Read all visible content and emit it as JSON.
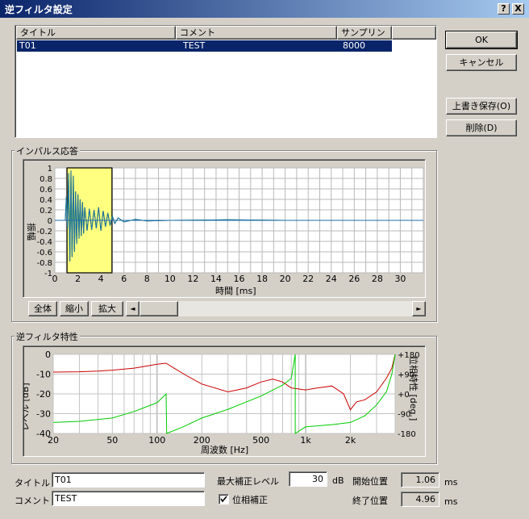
{
  "window": {
    "title": "逆フィルタ設定",
    "help_label": "?",
    "close_label": "X"
  },
  "list": {
    "columns": [
      "タイトル",
      "コメント",
      "サンプリング"
    ],
    "rows": [
      {
        "title": "T01",
        "comment": "TEST",
        "sampling": "8000"
      }
    ]
  },
  "buttons": {
    "ok": "OK",
    "cancel": "キャンセル",
    "overwrite": "上書き保存(O)",
    "delete": "削除(D)"
  },
  "impulse": {
    "group_label": "インパルス応答",
    "ylabel": "振幅",
    "xlabel": "時間 [ms]",
    "yticks": [
      "1",
      "0.8",
      "0.6",
      "0.4",
      "0.2",
      "0",
      "-0.2",
      "-0.4",
      "-0.6",
      "-0.8",
      "-1"
    ],
    "xticks": [
      "0",
      "2",
      "4",
      "6",
      "8",
      "10",
      "12",
      "14",
      "16",
      "18",
      "20",
      "22",
      "24",
      "26",
      "28",
      "30"
    ],
    "btn_all": "全体",
    "btn_shrink": "縮小",
    "btn_expand": "拡大",
    "scroll_left": "◄",
    "scroll_right": "►",
    "highlight_color": "#ffff80",
    "trace_color": "#1f6fa8",
    "fill_color": "#008000"
  },
  "filter": {
    "group_label": "逆フィルタ特性",
    "ylabel": "レベル [dB]",
    "y2label": "位相特性 [deg.]",
    "xlabel": "周波数 [Hz]",
    "yticks": [
      "0",
      "-10",
      "-20",
      "-30",
      "-40"
    ],
    "y2ticks": [
      "+180",
      "+90",
      "+0",
      "-90",
      "-180"
    ],
    "xticks": [
      "20",
      "50",
      "100",
      "200",
      "500",
      "1k",
      "2k"
    ],
    "level_color": "#cc0000",
    "phase_color": "#00cc00"
  },
  "chart_data": [
    {
      "type": "line",
      "title": "",
      "xlabel": "時間 [ms]",
      "ylabel": "振幅",
      "xlim": [
        0,
        32
      ],
      "ylim": [
        -1,
        1
      ],
      "highlight_range": [
        1.06,
        4.96
      ],
      "series": [
        {
          "x": [
            0.9,
            1.0,
            1.1,
            1.2,
            1.3,
            1.4,
            1.5,
            1.6,
            1.7,
            1.8,
            1.9,
            2.0,
            2.1,
            2.2,
            2.3,
            2.4,
            2.5,
            2.6,
            2.8,
            3.0,
            3.2,
            3.4,
            3.6,
            3.8,
            4.0,
            4.2,
            4.4,
            4.6,
            4.8,
            5.0,
            5.2,
            5.5,
            6.0,
            7.0,
            8.0,
            10.0,
            15.0,
            20.0,
            25.0,
            30.0,
            32.0
          ],
          "y": [
            0,
            0.45,
            -0.15,
            0.9,
            -0.78,
            0.95,
            -0.7,
            0.85,
            -0.6,
            0.55,
            -0.45,
            0.5,
            -0.35,
            0.4,
            -0.3,
            0.35,
            -0.25,
            0.25,
            -0.2,
            0.22,
            -0.18,
            0.2,
            -0.15,
            0.25,
            -0.2,
            0.18,
            -0.12,
            0.14,
            -0.1,
            0.08,
            -0.06,
            0.05,
            -0.03,
            0.02,
            -0.01,
            0,
            0.01,
            0,
            0,
            0,
            0
          ]
        }
      ]
    },
    {
      "type": "line",
      "title": "",
      "xlabel": "周波数 [Hz]",
      "ylabel": "レベル [dB]",
      "y2label": "位相特性 [deg.]",
      "xscale": "log",
      "xlim": [
        20,
        4000
      ],
      "ylim": [
        -40,
        0
      ],
      "y2lim": [
        -180,
        180
      ],
      "series": [
        {
          "axis": "left",
          "x": [
            20,
            30,
            40,
            50,
            70,
            100,
            115,
            130,
            160,
            200,
            300,
            400,
            500,
            600,
            700,
            800,
            1000,
            1200,
            1500,
            1800,
            2000,
            2200,
            2500,
            3000,
            3500,
            3800,
            4000
          ],
          "y": [
            -9,
            -8.8,
            -8.5,
            -8,
            -7,
            -5,
            -4.5,
            -7,
            -11,
            -15,
            -19,
            -17,
            -14,
            -12.5,
            -14,
            -17,
            -18,
            -17,
            -16,
            -20,
            -28,
            -24,
            -23,
            -19,
            -12,
            -7,
            0
          ]
        },
        {
          "axis": "right",
          "x": [
            20,
            30,
            50,
            70,
            100,
            115,
            116,
            150,
            200,
            300,
            500,
            700,
            800,
            850,
            851,
            1000,
            1500,
            2000,
            2500,
            3000,
            3500,
            3800,
            4000
          ],
          "y": [
            -130,
            -125,
            -110,
            -80,
            -40,
            0,
            -180,
            -150,
            -110,
            -70,
            -10,
            40,
            70,
            180,
            -180,
            -150,
            -140,
            -130,
            -100,
            -50,
            10,
            90,
            180
          ]
        }
      ]
    }
  ],
  "fields": {
    "title_label": "タイトル",
    "title_value": "T01",
    "comment_label": "コメント",
    "comment_value": "TEST",
    "max_level_label": "最大補正レベル",
    "max_level_value": "30",
    "max_level_unit": "dB",
    "phase_label": "位相補正",
    "phase_checked": true,
    "start_label": "開始位置",
    "start_value": "1.06",
    "start_unit": "ms",
    "end_label": "終了位置",
    "end_value": "4.96",
    "end_unit": "ms"
  }
}
